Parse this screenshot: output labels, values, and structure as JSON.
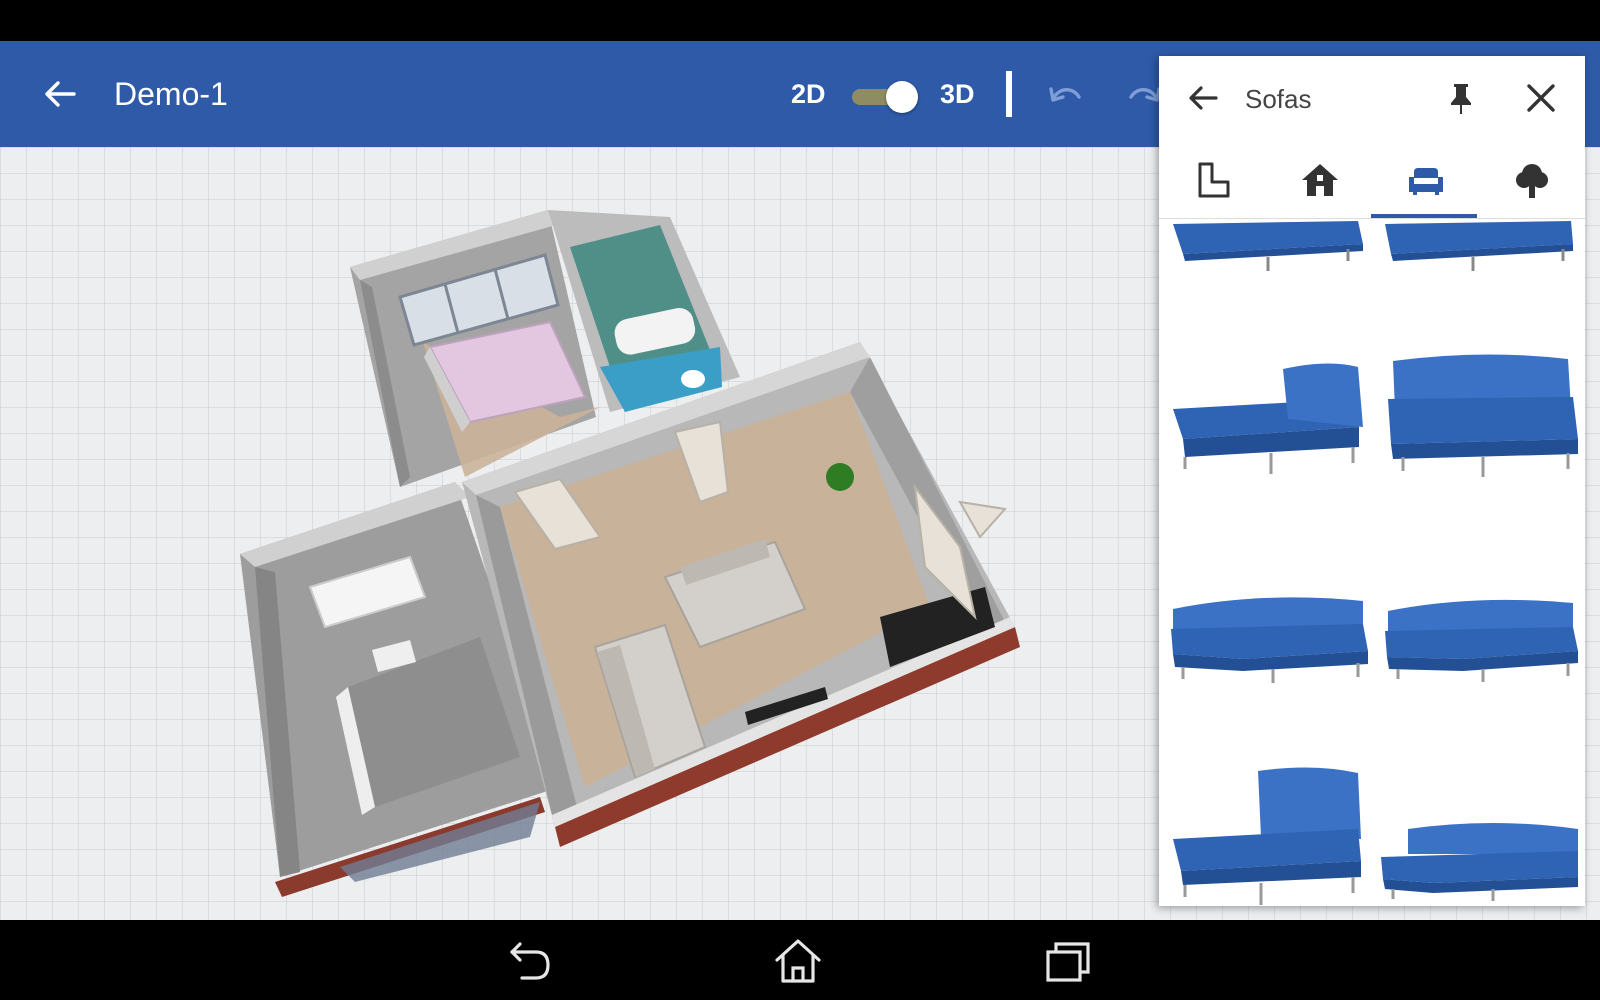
{
  "app_bar": {
    "title": "Demo-1",
    "mode_2d_label": "2D",
    "mode_3d_label": "3D",
    "view_mode": "3D"
  },
  "panel": {
    "title": "Sofas",
    "tabs": [
      {
        "icon": "floor-plan-icon",
        "selected": false
      },
      {
        "icon": "home-icon",
        "selected": false
      },
      {
        "icon": "sofa-icon",
        "selected": true
      },
      {
        "icon": "tree-icon",
        "selected": false
      }
    ],
    "items": [
      {
        "icon": "sofa-chaise-partial-icon"
      },
      {
        "icon": "sofa-chaise-partial-icon"
      },
      {
        "icon": "chaise-longue-sofa-icon"
      },
      {
        "icon": "corner-sofa-section-icon"
      },
      {
        "icon": "corner-sofa-icon"
      },
      {
        "icon": "corner-sofa-icon"
      },
      {
        "icon": "chaise-longue-sofa-icon"
      },
      {
        "icon": "l-shaped-sofa-icon"
      }
    ]
  },
  "colors": {
    "app_bar": "#2e5aa8",
    "sofa_blue": "#2f63b4",
    "tab_indicator": "#2e5aa8"
  }
}
